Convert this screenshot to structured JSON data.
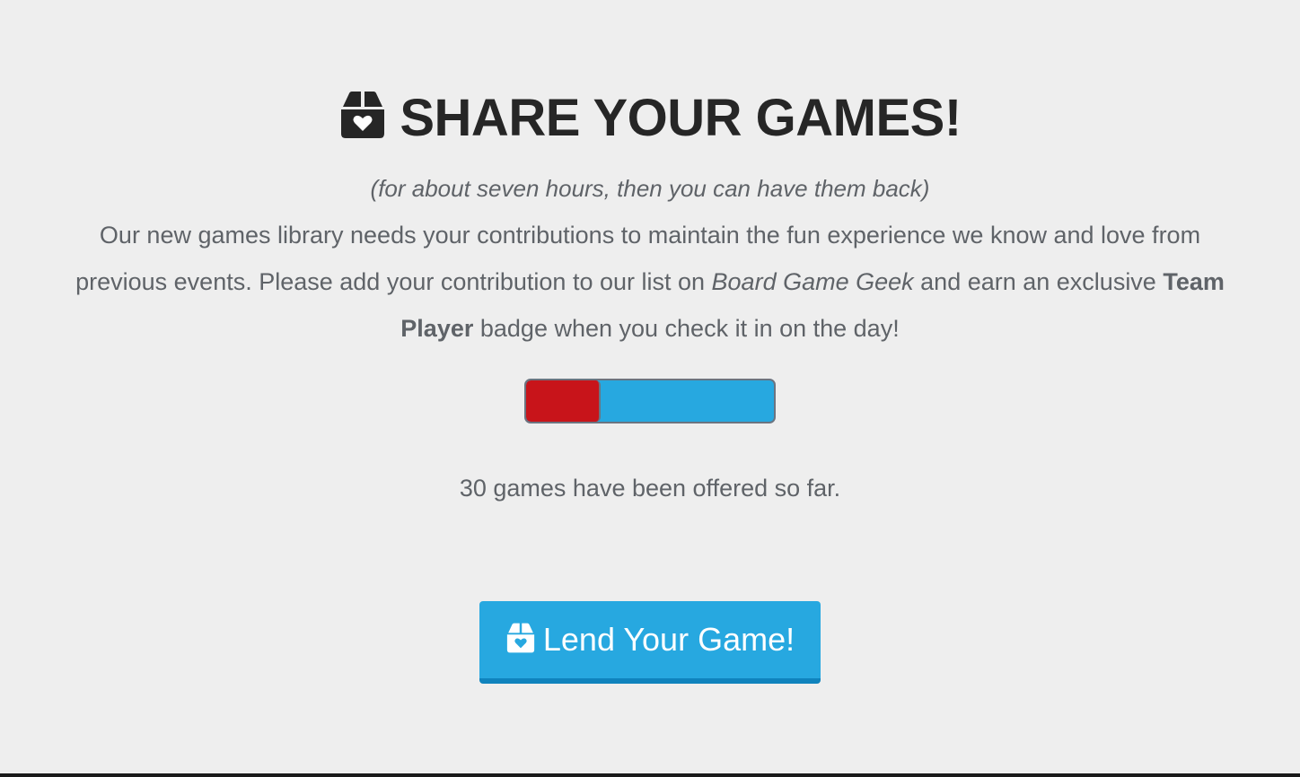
{
  "header": {
    "title": "SHARE YOUR GAMES!",
    "icon": "box-heart-icon",
    "subtitle": "(for about seven hours, then you can have them back)"
  },
  "description": {
    "part1": "Our new games library needs your contributions to maintain the fun experience we know and love from previous events. Please add your contribution to our list on ",
    "link_text": "Board Game Geek",
    "part2": " and earn an exclusive ",
    "badge_name": "Team Player",
    "part3": " badge when you check it in on the day!"
  },
  "progress": {
    "fraction": 0.3,
    "fill_color": "#c8141a",
    "track_color": "#27a8e0"
  },
  "status": {
    "count_text": "30 games have been offered so far."
  },
  "cta": {
    "label": "Lend Your Game!",
    "icon": "box-heart-icon",
    "color": "#27a8e0"
  }
}
